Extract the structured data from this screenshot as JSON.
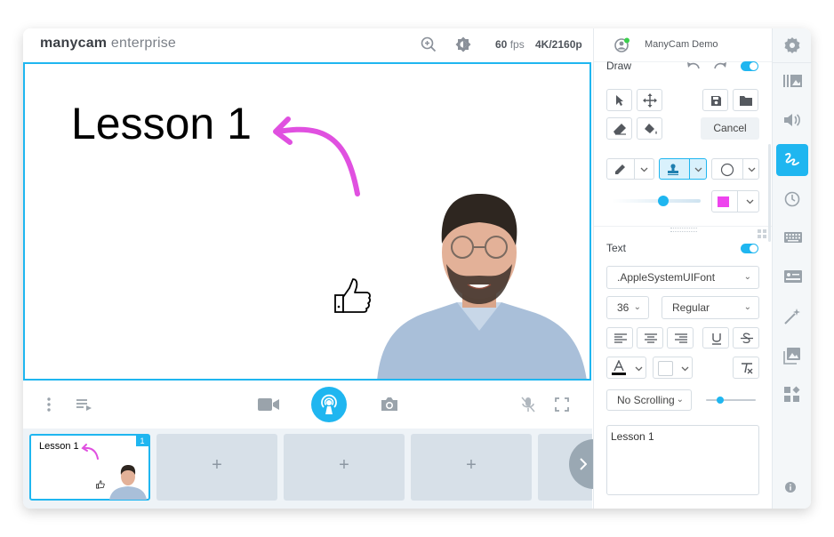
{
  "brand": {
    "bold": "manycam",
    "light": " enterprise"
  },
  "topbar": {
    "fps_value": "60",
    "fps_unit": "fps",
    "resolution": "4K/2160p"
  },
  "account": {
    "user_name": "ManyCam Demo"
  },
  "canvas": {
    "lesson_text": "Lesson 1"
  },
  "scenes": [
    {
      "label": "Lesson 1",
      "badge": "1",
      "active": true
    },
    {
      "plus": "+"
    },
    {
      "plus": "+"
    },
    {
      "plus": "+"
    }
  ],
  "draw_panel": {
    "title": "Draw",
    "cancel_label": "Cancel",
    "color_swatch": "#ee44ee"
  },
  "text_panel": {
    "title": "Text",
    "font": ".AppleSystemUIFont",
    "size": "36",
    "weight": "Regular",
    "scrolling": "No Scrolling",
    "content": "Lesson 1"
  },
  "colors": {
    "accent": "#1fb6f0",
    "draw": "#e050e0"
  }
}
